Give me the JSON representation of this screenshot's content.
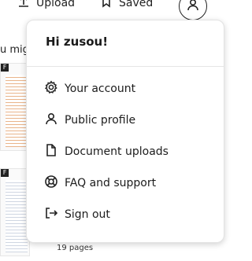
{
  "topbar": {
    "upload_label": "Upload",
    "saved_label": "Saved"
  },
  "background": {
    "snippet_text": "u mig",
    "tag_label": "F",
    "pages_label": "19 pages"
  },
  "menu": {
    "greeting": "Hi zusou!",
    "items": [
      {
        "label": "Your account",
        "icon": "gear-icon"
      },
      {
        "label": "Public profile",
        "icon": "person-icon"
      },
      {
        "label": "Document uploads",
        "icon": "document-icon"
      },
      {
        "label": "FAQ and support",
        "icon": "lifebuoy-icon"
      },
      {
        "label": "Sign out",
        "icon": "sign-out-icon"
      }
    ]
  }
}
